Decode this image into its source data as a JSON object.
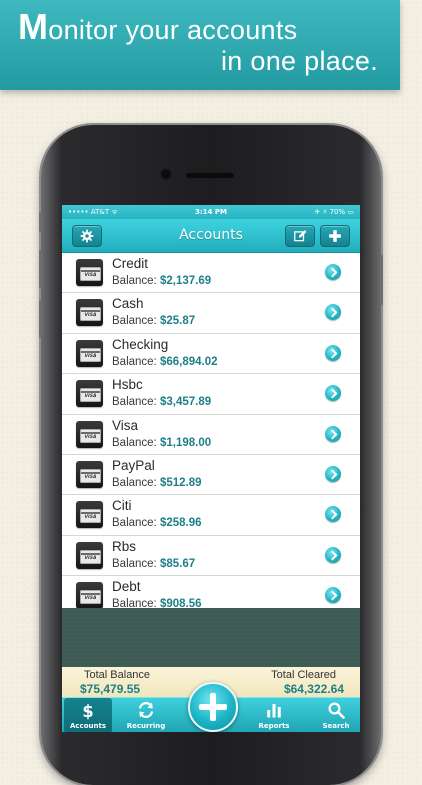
{
  "banner": {
    "line1_initial": "M",
    "line1_rest": "onitor your accounts",
    "line2": "in one place."
  },
  "status_bar": {
    "carrier": "••••• AT&T ᯤ",
    "time": "3:14 PM",
    "battery": "✈ ⚡ 70% ▭"
  },
  "nav": {
    "title": "Accounts",
    "settings_icon": "gear-icon",
    "edit_icon": "edit-icon",
    "add_icon": "plus-icon"
  },
  "accounts": [
    {
      "name": "Credit",
      "balance_label": "Balance:",
      "balance": "$2,137.69"
    },
    {
      "name": "Cash",
      "balance_label": "Balance:",
      "balance": "$25.87"
    },
    {
      "name": "Checking",
      "balance_label": "Balance:",
      "balance": "$66,894.02"
    },
    {
      "name": "Hsbc",
      "balance_label": "Balance:",
      "balance": "$3,457.89"
    },
    {
      "name": "Visa",
      "balance_label": "Balance:",
      "balance": "$1,198.00"
    },
    {
      "name": "PayPal",
      "balance_label": "Balance:",
      "balance": "$512.89"
    },
    {
      "name": "Citi",
      "balance_label": "Balance:",
      "balance": "$258.96"
    },
    {
      "name": "Rbs",
      "balance_label": "Balance:",
      "balance": "$85.67"
    },
    {
      "name": "Debt",
      "balance_label": "Balance:",
      "balance": "$908.56"
    }
  ],
  "card_icon_text": "VISA",
  "totals": {
    "balance_label": "Total Balance",
    "balance_value": "$75,479.55",
    "cleared_label": "Total Cleared",
    "cleared_value": "$64,322.64"
  },
  "tabs": {
    "accounts": "Accounts",
    "recurring": "Recurring",
    "reports": "Reports",
    "search": "Search"
  },
  "colors": {
    "accent": "#21aebd",
    "amount": "#1d7f88",
    "banner": "#2aa6ad"
  }
}
